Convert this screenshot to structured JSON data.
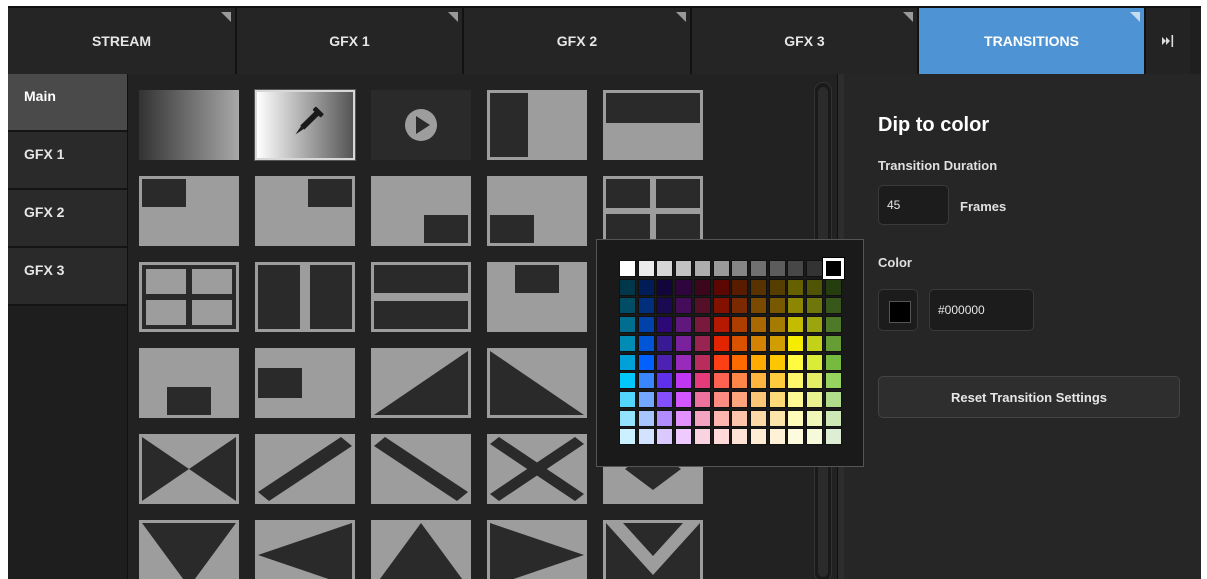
{
  "tabs": [
    {
      "label": "STREAM",
      "active": false
    },
    {
      "label": "GFX 1",
      "active": false
    },
    {
      "label": "GFX 2",
      "active": false
    },
    {
      "label": "GFX 3",
      "active": false
    },
    {
      "label": "TRANSITIONS",
      "active": true
    }
  ],
  "tab_end_icon": "skip-forward-icon",
  "sidebar": {
    "items": [
      {
        "label": "Main",
        "active": true
      },
      {
        "label": "GFX 1",
        "active": false
      },
      {
        "label": "GFX 2",
        "active": false
      },
      {
        "label": "GFX 3",
        "active": false
      }
    ]
  },
  "transitions_grid": {
    "selected": "dip-to-color",
    "items": [
      "gradient-fade",
      "dip-to-color",
      "play-icon",
      "wipe-left-bar",
      "wipe-top-bar",
      "box-top-left",
      "box-top-right",
      "box-bottom-right",
      "box-bottom-left",
      "quad-split",
      "quad-grid",
      "vertical-split",
      "horizontal-split",
      "box-top-center",
      "",
      "box-bottom-center",
      "box-left",
      "diagonal-wipe-up",
      "diagonal-wipe-down",
      "",
      "hourglass",
      "diagonal-bar-up",
      "diagonal-bar-down",
      "x-cross",
      "diamond",
      "triangle-down",
      "triangle-left",
      "triangle-up",
      "triangle-right",
      "v-shape"
    ]
  },
  "panel": {
    "title": "Dip to color",
    "duration_label": "Transition Duration",
    "duration_value": "45",
    "duration_unit": "Frames",
    "color_label": "Color",
    "color_value": "#000000",
    "color_swatch": "#000000",
    "reset_label": "Reset Transition Settings"
  },
  "color_picker": {
    "selected": "#000000",
    "rows": [
      [
        "#ffffff",
        "#ebebeb",
        "#d6d6d6",
        "#c2c2c2",
        "#adadad",
        "#999999",
        "#858585",
        "#707070",
        "#5c5c5c",
        "#474747",
        "#333333",
        "#000000"
      ],
      [
        "#00374a",
        "#011d57",
        "#11053b",
        "#2e063d",
        "#3c071b",
        "#5c0701",
        "#5a1c00",
        "#583300",
        "#563d00",
        "#666100",
        "#4f5504",
        "#263e0f"
      ],
      [
        "#004d65",
        "#012f7b",
        "#1a0a52",
        "#450d59",
        "#551029",
        "#831100",
        "#7b2900",
        "#7a4a00",
        "#785800",
        "#8c8602",
        "#6f760a",
        "#38571a"
      ],
      [
        "#016e8f",
        "#0042a9",
        "#2c0977",
        "#61187c",
        "#791a3d",
        "#b51a00",
        "#ad3e00",
        "#a96800",
        "#a67b01",
        "#c4bc00",
        "#9ba50e",
        "#4e7a27"
      ],
      [
        "#008cb4",
        "#0056d6",
        "#371a94",
        "#7a219e",
        "#99244f",
        "#e22400",
        "#da5100",
        "#d38301",
        "#d19d01",
        "#f5ec00",
        "#c3d117",
        "#669d34"
      ],
      [
        "#00a1d8",
        "#0061fe",
        "#4d22b2",
        "#982abc",
        "#b92d5d",
        "#ff4015",
        "#ff6a00",
        "#ffab01",
        "#fcc700",
        "#fefb41",
        "#d9ec37",
        "#76bb40"
      ],
      [
        "#01c7fc",
        "#3a87fd",
        "#5e30eb",
        "#be38f3",
        "#e63b7a",
        "#fe6250",
        "#fe8648",
        "#feb43f",
        "#fecb3e",
        "#fff76b",
        "#e4ef65",
        "#96d35f"
      ],
      [
        "#52d6fc",
        "#74a7ff",
        "#864ffd",
        "#d357fe",
        "#ee719e",
        "#ff8c82",
        "#fea57d",
        "#fec777",
        "#fed977",
        "#fff994",
        "#eaf28f",
        "#b1dd8b"
      ],
      [
        "#93e3fc",
        "#a7c6ff",
        "#b18cfe",
        "#e292fe",
        "#f4a4c0",
        "#ffb5af",
        "#ffc5ab",
        "#fed9a8",
        "#fde4a8",
        "#fffbb9",
        "#f1f7b7",
        "#cde8b5"
      ],
      [
        "#cbf0ff",
        "#d3e2ff",
        "#d9c9fe",
        "#efcaff",
        "#f9d3e0",
        "#ffdad8",
        "#ffe2d6",
        "#feecd4",
        "#fef1d5",
        "#fdfbdd",
        "#f6fadb",
        "#deeed4"
      ]
    ]
  }
}
